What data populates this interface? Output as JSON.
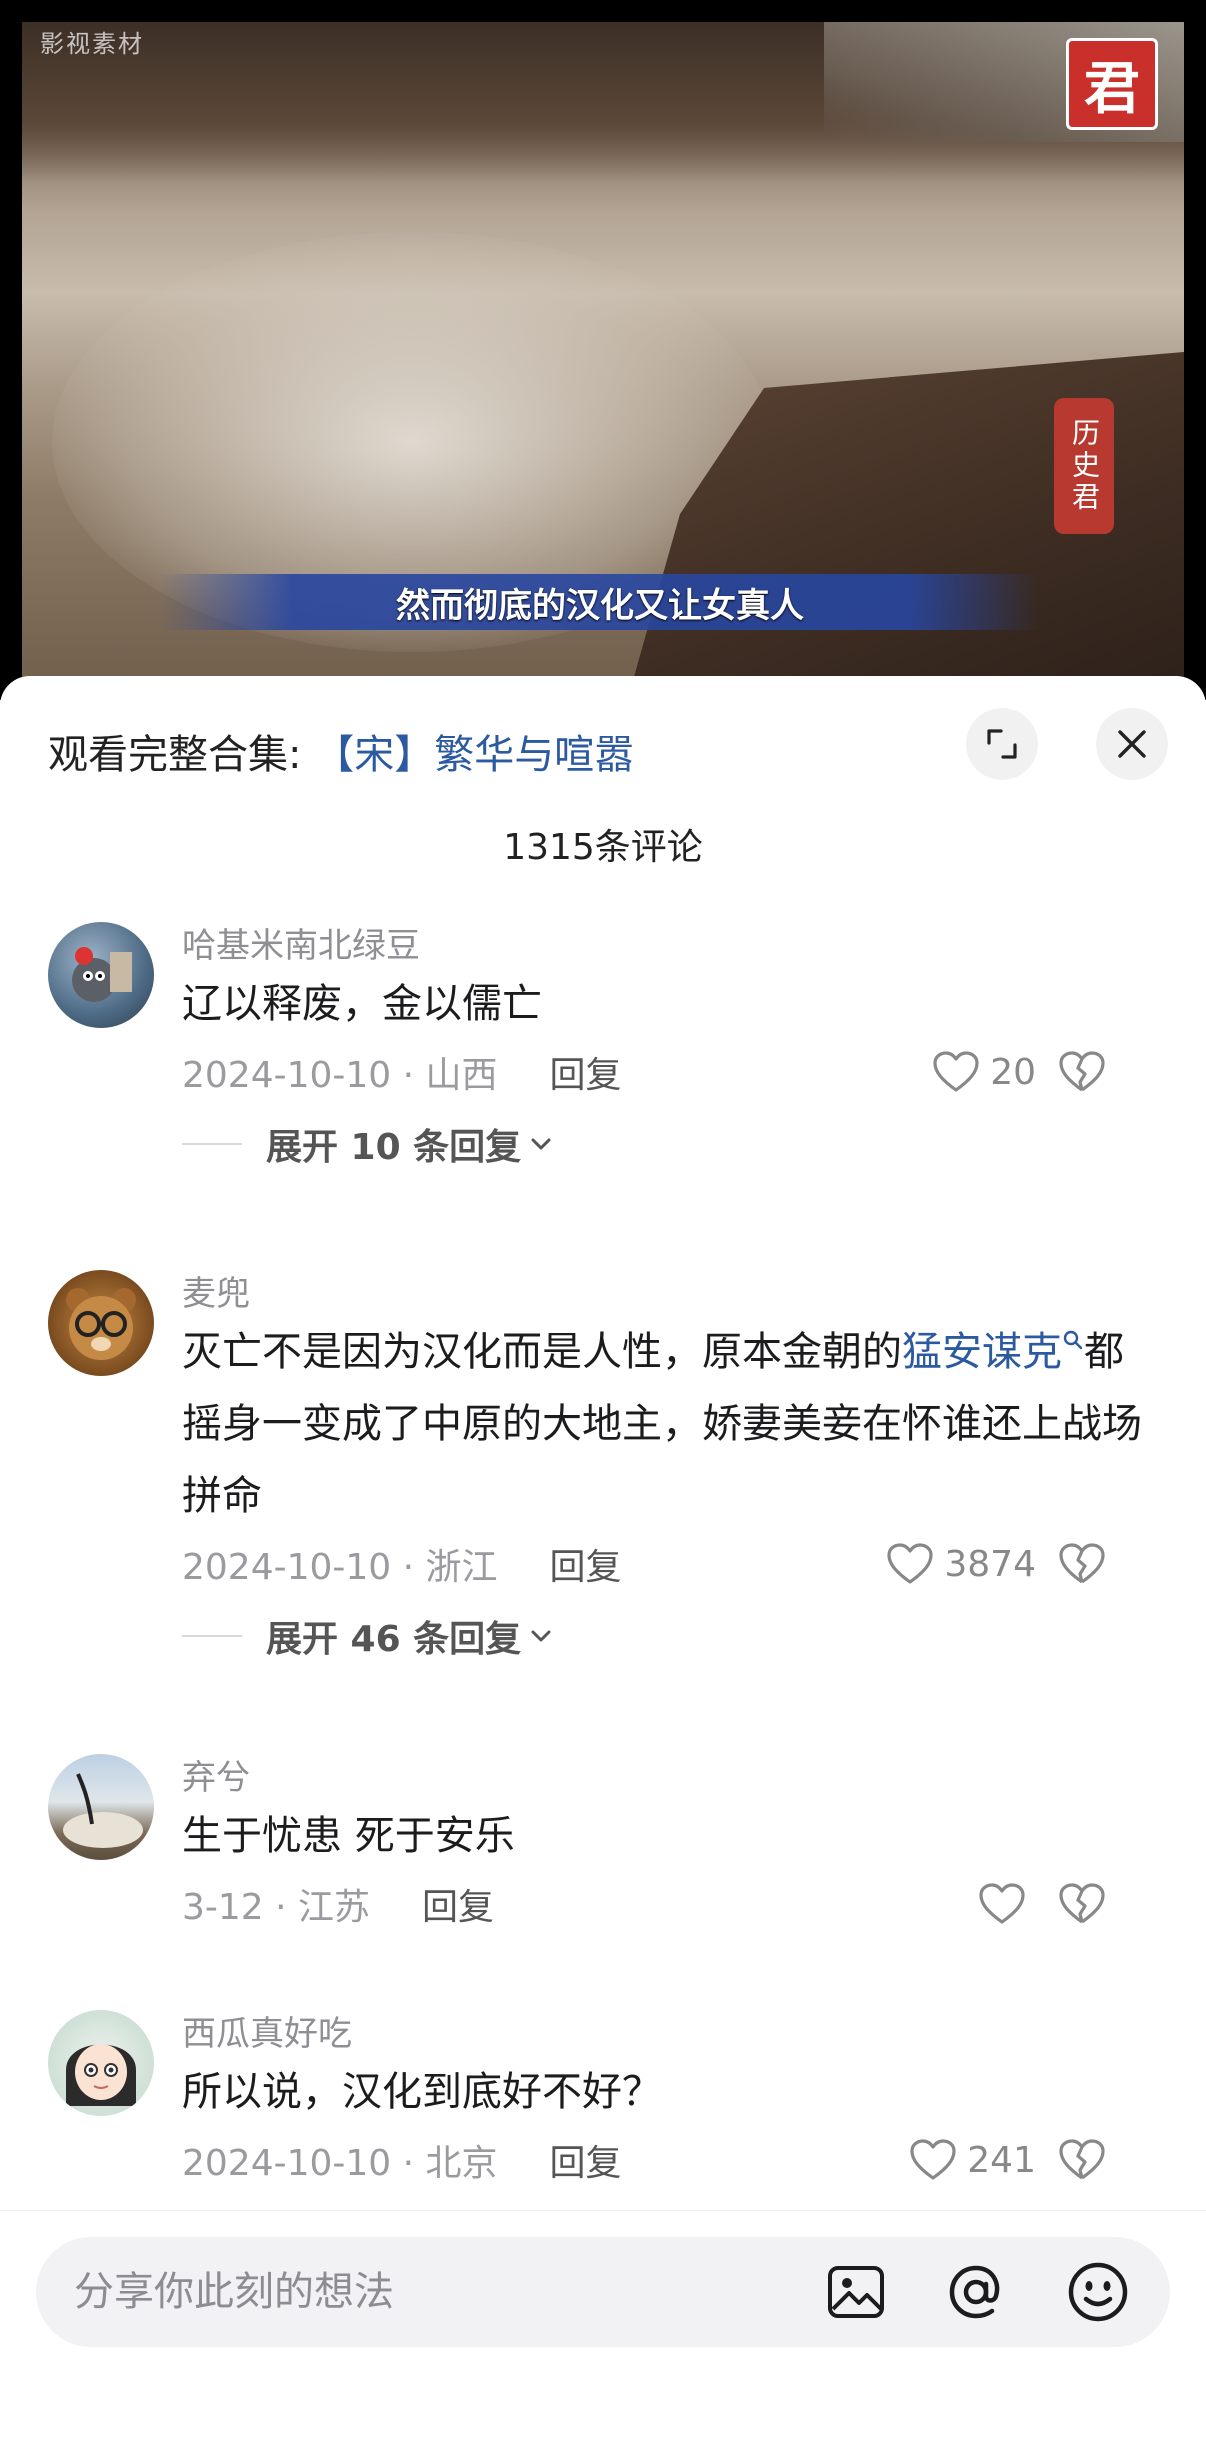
{
  "video": {
    "watermark": "影视素材",
    "logo_char": "君",
    "seal_text": "历史君",
    "subtitle": "然而彻底的汉化又让女真人"
  },
  "sheet": {
    "collection_prefix": "观看完整合集: ",
    "collection_name": "【宋】繁华与喧嚣",
    "comment_count": "1315条评论"
  },
  "comments": [
    {
      "username": "哈基米南北绿豆",
      "text": "辽以释废，金以儒亡",
      "date_loc": "2024-10-10 · 山西",
      "reply_label": "回复",
      "likes": "20",
      "expand_label": "展开 10 条回复"
    },
    {
      "username": "麦兜",
      "text_before": "灭亡不是因为汉化而是人性，原本金朝的",
      "keyword": "猛安谋克",
      "text_after": "都摇身一变成了中原的大地主，娇妻美妾在怀谁还上战场拼命",
      "date_loc": "2024-10-10 · 浙江",
      "reply_label": "回复",
      "likes": "3874",
      "expand_label": "展开 46 条回复"
    },
    {
      "username": "弃兮",
      "text": "生于忧患 死于安乐",
      "date_loc": "3-12 · 江苏",
      "reply_label": "回复",
      "likes": ""
    },
    {
      "username": "西瓜真好吃",
      "text": "所以说，汉化到底好不好？",
      "date_loc": "2024-10-10 · 北京",
      "reply_label": "回复",
      "likes": "241"
    }
  ],
  "input": {
    "placeholder": "分享你此刻的想法"
  },
  "icons": [
    "expand-icon",
    "close-icon",
    "heart-icon",
    "broken-heart-icon",
    "chevron-down-icon",
    "image-icon",
    "at-icon",
    "emoji-icon",
    "search-icon"
  ],
  "colors": {
    "link": "#2c5aa0",
    "seal_red": "#c9302c"
  }
}
